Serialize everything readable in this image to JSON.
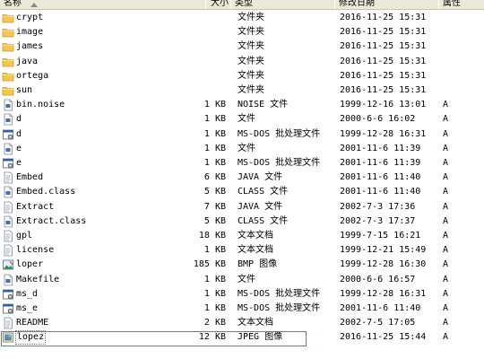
{
  "columns": {
    "name": "名称",
    "size": "大小",
    "type": "类型",
    "modified": "修改日期",
    "attributes": "属性"
  },
  "files": [
    {
      "name": "crypt",
      "size": "",
      "type": "文件夹",
      "modified": "2016-11-25 15:31",
      "attr": "",
      "icon": "folder-icon"
    },
    {
      "name": "image",
      "size": "",
      "type": "文件夹",
      "modified": "2016-11-25 15:31",
      "attr": "",
      "icon": "folder-icon"
    },
    {
      "name": "james",
      "size": "",
      "type": "文件夹",
      "modified": "2016-11-25 15:31",
      "attr": "",
      "icon": "folder-icon"
    },
    {
      "name": "java",
      "size": "",
      "type": "文件夹",
      "modified": "2016-11-25 15:31",
      "attr": "",
      "icon": "folder-icon"
    },
    {
      "name": "ortega",
      "size": "",
      "type": "文件夹",
      "modified": "2016-11-25 15:31",
      "attr": "",
      "icon": "folder-icon"
    },
    {
      "name": "sun",
      "size": "",
      "type": "文件夹",
      "modified": "2016-11-25 15:31",
      "attr": "",
      "icon": "folder-icon"
    },
    {
      "name": "bin.noise",
      "size": "1 KB",
      "type": "NOISE 文件",
      "modified": "1999-12-16 13:01",
      "attr": "A",
      "icon": "generic-file-icon"
    },
    {
      "name": "d",
      "size": "1 KB",
      "type": "文件",
      "modified": "2000-6-6 16:02",
      "attr": "A",
      "icon": "generic-file-icon"
    },
    {
      "name": "d",
      "size": "1 KB",
      "type": "MS-DOS 批处理文件",
      "modified": "1999-12-28 16:31",
      "attr": "A",
      "icon": "batch-file-icon"
    },
    {
      "name": "e",
      "size": "1 KB",
      "type": "文件",
      "modified": "2001-11-6 11:39",
      "attr": "A",
      "icon": "generic-file-icon"
    },
    {
      "name": "e",
      "size": "1 KB",
      "type": "MS-DOS 批处理文件",
      "modified": "2001-11-6 11:39",
      "attr": "A",
      "icon": "batch-file-icon"
    },
    {
      "name": "Embed",
      "size": "6 KB",
      "type": "JAVA 文件",
      "modified": "2001-11-6 11:40",
      "attr": "A",
      "icon": "text-file-icon"
    },
    {
      "name": "Embed.class",
      "size": "5 KB",
      "type": "CLASS 文件",
      "modified": "2001-11-6 11:40",
      "attr": "A",
      "icon": "generic-file-icon"
    },
    {
      "name": "Extract",
      "size": "7 KB",
      "type": "JAVA 文件",
      "modified": "2002-7-3 17:36",
      "attr": "A",
      "icon": "text-file-icon"
    },
    {
      "name": "Extract.class",
      "size": "5 KB",
      "type": "CLASS 文件",
      "modified": "2002-7-3 17:37",
      "attr": "A",
      "icon": "generic-file-icon"
    },
    {
      "name": "gpl",
      "size": "18 KB",
      "type": "文本文档",
      "modified": "1999-7-15 16:21",
      "attr": "A",
      "icon": "text-file-icon"
    },
    {
      "name": "license",
      "size": "1 KB",
      "type": "文本文档",
      "modified": "1999-12-21 15:49",
      "attr": "A",
      "icon": "text-file-icon"
    },
    {
      "name": "loper",
      "size": "185 KB",
      "type": "BMP 图像",
      "modified": "1999-12-28 16:30",
      "attr": "A",
      "icon": "bitmap-image-icon"
    },
    {
      "name": "Makefile",
      "size": "1 KB",
      "type": "文件",
      "modified": "2000-6-6 16:57",
      "attr": "A",
      "icon": "generic-file-icon"
    },
    {
      "name": "ms_d",
      "size": "1 KB",
      "type": "MS-DOS 批处理文件",
      "modified": "1999-12-28 16:31",
      "attr": "A",
      "icon": "batch-file-icon"
    },
    {
      "name": "ms_e",
      "size": "1 KB",
      "type": "MS-DOS 批处理文件",
      "modified": "2001-11-6 11:40",
      "attr": "A",
      "icon": "batch-file-icon"
    },
    {
      "name": "README",
      "size": "2 KB",
      "type": "文本文档",
      "modified": "2002-7-5 17:05",
      "attr": "A",
      "icon": "text-file-icon"
    },
    {
      "name": "lopez",
      "size": "12 KB",
      "type": "JPEG 图像",
      "modified": "2016-11-25 15:44",
      "attr": "A",
      "icon": "jpeg-image-icon",
      "selected": true
    }
  ],
  "colors": {
    "header_bg": "#ece9d8",
    "folder": "#f2c94c",
    "highlight_border": "#e05050"
  }
}
